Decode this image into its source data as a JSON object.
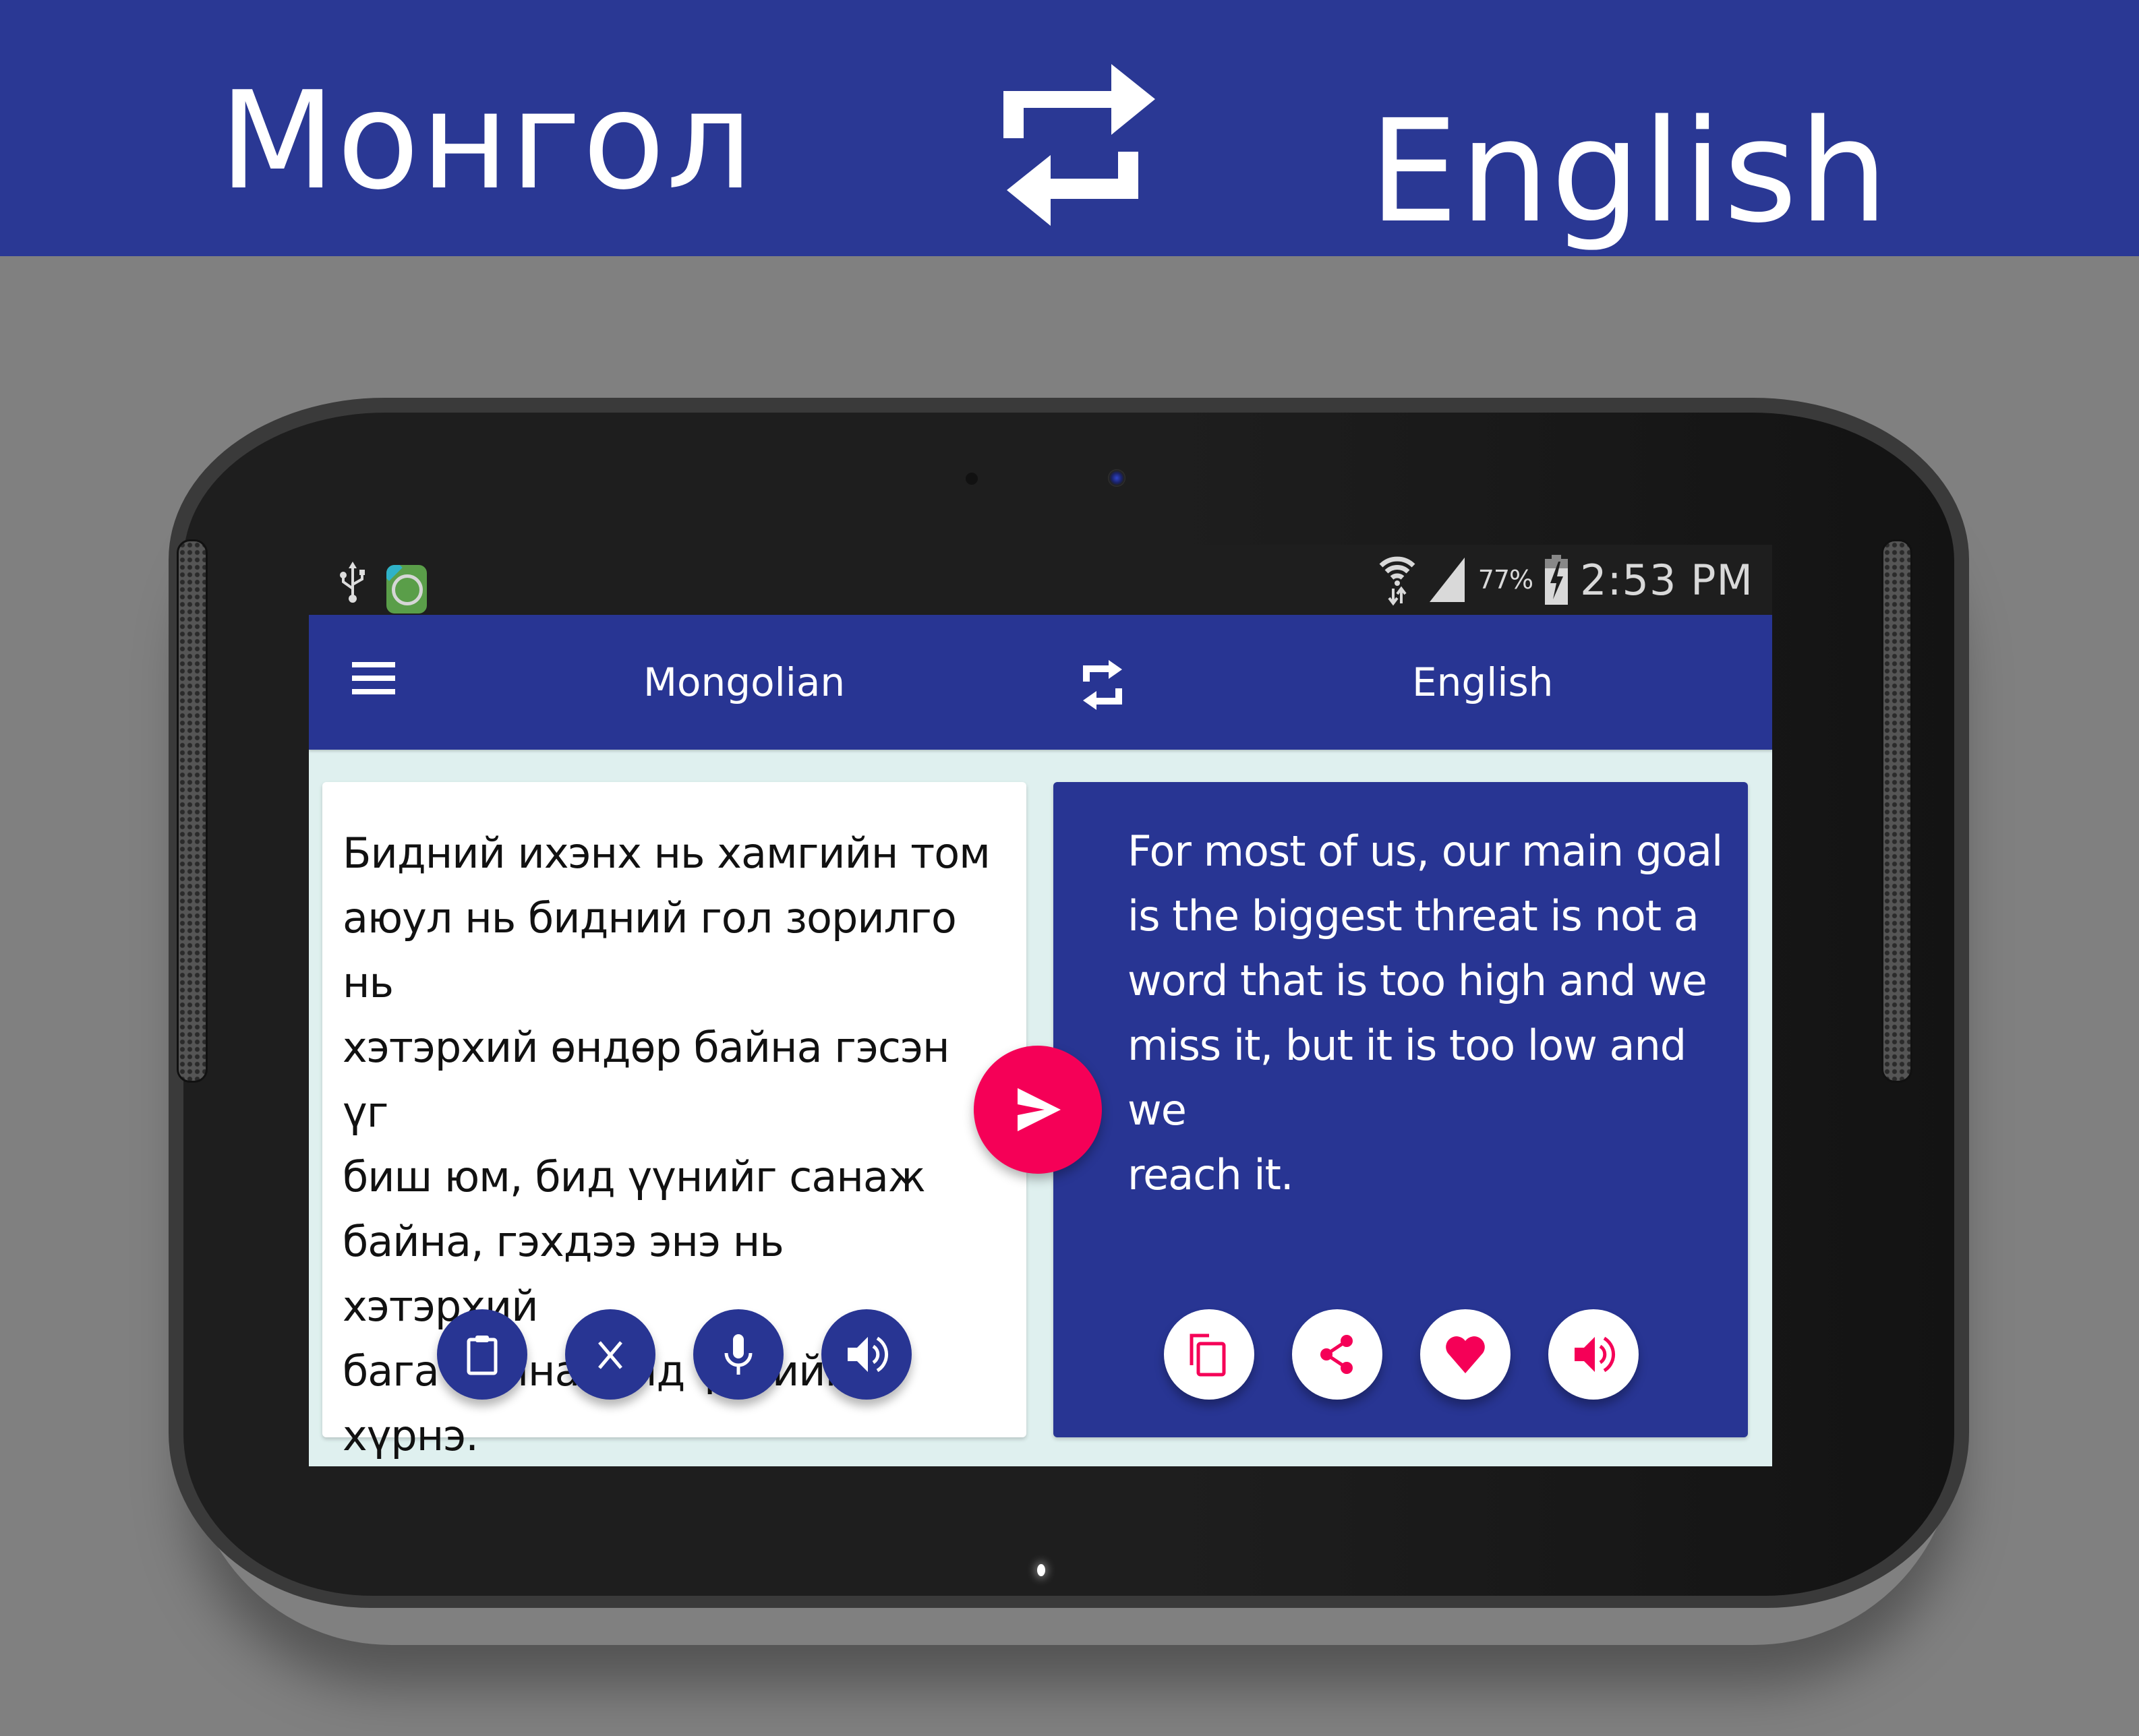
{
  "banner": {
    "source_language": "Монгол",
    "target_language": "English",
    "swap_icon": "swap-arrows-icon"
  },
  "status_bar": {
    "left_icons": [
      "usb-icon",
      "app-notification-icon"
    ],
    "right_icons": [
      "wifi-icon",
      "signal-icon",
      "battery-charging-icon"
    ],
    "battery_percent": "77%",
    "time": "2:53 PM"
  },
  "app_bar": {
    "menu_icon": "hamburger-menu-icon",
    "source_language": "Mongolian",
    "swap_icon": "swap-arrows-icon",
    "target_language": "English"
  },
  "source_card": {
    "text": "Бидний ихэнх нь хамгийн том\nаюул нь бидний гол зорилго нь\nхэтэрхий өндөр байна гэсэн үг\nбиш юм, бид үүнийг санаж\nбайна, гэхдээ энэ нь хэтэрхий\nбага байна, бид үүнийг хүрнэ.",
    "actions": [
      {
        "name": "paste",
        "icon": "clipboard-icon"
      },
      {
        "name": "clear",
        "icon": "close-icon"
      },
      {
        "name": "voice-input",
        "icon": "microphone-icon"
      },
      {
        "name": "speak",
        "icon": "speaker-icon"
      }
    ]
  },
  "translate_button": {
    "icon": "send-icon"
  },
  "target_card": {
    "text": "For most of us, our main goal\nis the biggest threat is not a\nword that is too high and we\nmiss it, but it is too low and we\nreach it.",
    "actions": [
      {
        "name": "copy",
        "icon": "copy-icon"
      },
      {
        "name": "share",
        "icon": "share-icon"
      },
      {
        "name": "favorite",
        "icon": "heart-icon"
      },
      {
        "name": "speak",
        "icon": "speaker-icon"
      }
    ]
  },
  "colors": {
    "primary": "#283593",
    "accent": "#f50057",
    "content_background": "#dff0ef",
    "page_background": "#808080"
  }
}
